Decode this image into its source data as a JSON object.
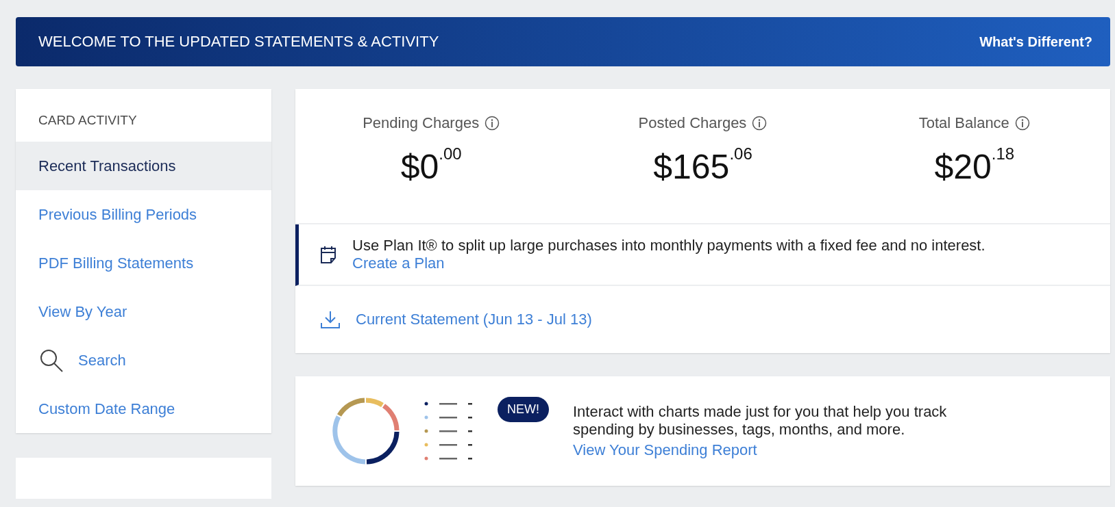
{
  "banner": {
    "title": "WELCOME TO THE UPDATED STATEMENTS & ACTIVITY",
    "link": "What's Different?"
  },
  "sidebar": {
    "heading": "CARD ACTIVITY",
    "items": [
      {
        "label": "Recent Transactions",
        "selected": true,
        "kind": "link"
      },
      {
        "label": "Previous Billing Periods",
        "selected": false,
        "kind": "link"
      },
      {
        "label": "PDF Billing Statements",
        "selected": false,
        "kind": "link"
      },
      {
        "label": "View By Year",
        "selected": false,
        "kind": "link"
      },
      {
        "label": "Search",
        "selected": false,
        "kind": "search"
      },
      {
        "label": "Custom Date Range",
        "selected": false,
        "kind": "link"
      }
    ]
  },
  "summary": [
    {
      "label": "Pending Charges",
      "amount": "$0$^{.00}$"
    },
    {
      "label": "Posted Charges",
      "amount": "$165$^{.06}$"
    },
    {
      "label": "Total Balance",
      "amount": "$20$^{.18}$"
    }
  ],
  "plan": {
    "text": "Use Plan It® to split up large purchases into monthly payments with a fixed fee and no interest.",
    "link": "Create a Plan"
  },
  "statement": {
    "link": "Current Statement (Jun 13 - Jul 13)"
  },
  "promo": {
    "badge": "NEW!",
    "text": "Interact with charts made just for you that help you track spending by businesses, tags, months, and more.",
    "link": "View Your Spending Report"
  }
}
